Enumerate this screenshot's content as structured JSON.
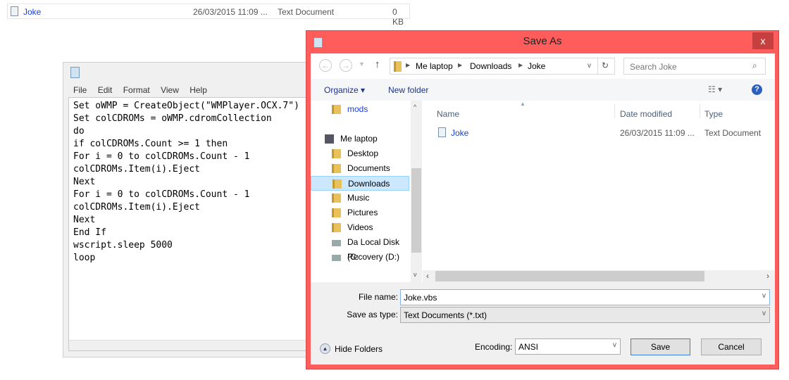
{
  "background_row": {
    "name": "Joke",
    "date": "26/03/2015 11:09 ...",
    "type": "Text Document",
    "size": "0 KB"
  },
  "notepad": {
    "menu": [
      "File",
      "Edit",
      "Format",
      "View",
      "Help"
    ],
    "lines": [
      "Set oWMP = CreateObject(\"WMPlayer.OCX.7\")",
      "Set colCDROMs = oWMP.cdromCollection",
      "do",
      "if colCDROMs.Count >= 1 then",
      "For i = 0 to colCDROMs.Count - 1",
      "colCDROMs.Item(i).Eject",
      "Next",
      "For i = 0 to colCDROMs.Count - 1",
      "colCDROMs.Item(i).Eject",
      "Next",
      "End If",
      "wscript.sleep 5000",
      "loop"
    ]
  },
  "dialog": {
    "title": "Save As",
    "close": "x",
    "breadcrumb": [
      "Me laptop",
      "Downloads",
      "Joke"
    ],
    "search_placeholder": "Search Joke",
    "toolbar": {
      "organize": "Organize",
      "new_folder": "New folder"
    },
    "nav": [
      "mods",
      "Me laptop",
      "Desktop",
      "Documents",
      "Downloads",
      "Music",
      "Pictures",
      "Videos",
      "Da Local Disk (C:",
      "Recovery (D:)"
    ],
    "nav_selected": "Downloads",
    "columns": [
      "Name",
      "Date modified",
      "Type"
    ],
    "files": [
      {
        "name": "Joke",
        "date": "26/03/2015 11:09 ...",
        "type": "Text Document"
      }
    ],
    "file_name_label": "File name:",
    "file_name": "Joke.vbs",
    "type_label": "Save as type:",
    "type_value": "Text Documents (*.txt)",
    "hide_folders": "Hide Folders",
    "encoding_label": "Encoding:",
    "encoding": "ANSI",
    "save": "Save",
    "cancel": "Cancel",
    "colors": {
      "frame": "#ff5c5c",
      "close": "#c74040",
      "selection": "#cce8ff"
    }
  }
}
